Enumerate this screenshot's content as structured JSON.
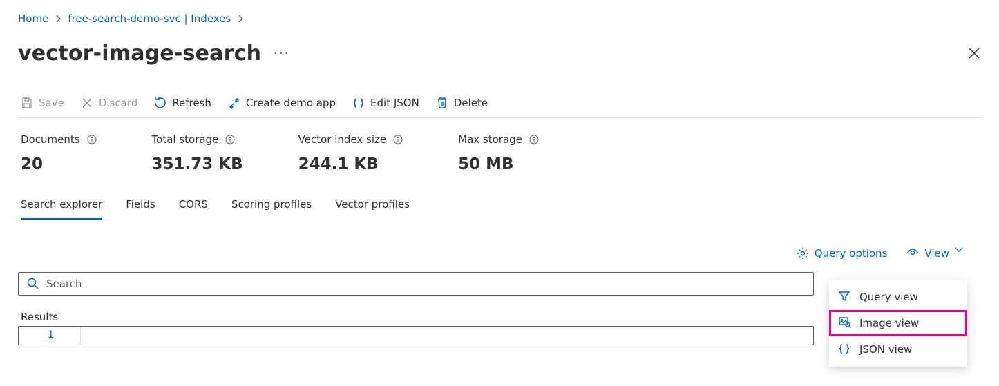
{
  "breadcrumb": {
    "home": "Home",
    "service": "free-search-demo-svc | Indexes"
  },
  "title": "vector-image-search",
  "toolbar": {
    "save": "Save",
    "discard": "Discard",
    "refresh": "Refresh",
    "create_demo": "Create demo app",
    "edit_json": "Edit JSON",
    "delete": "Delete"
  },
  "stats": {
    "documents": {
      "label": "Documents",
      "value": "20"
    },
    "total_storage": {
      "label": "Total storage",
      "value": "351.73 KB"
    },
    "vector_index": {
      "label": "Vector index size",
      "value": "244.1 KB"
    },
    "max_storage": {
      "label": "Max storage",
      "value": "50 MB"
    }
  },
  "tabs": {
    "search_explorer": "Search explorer",
    "fields": "Fields",
    "cors": "CORS",
    "scoring": "Scoring profiles",
    "vector": "Vector profiles"
  },
  "options": {
    "query_options": "Query options",
    "view": "View"
  },
  "search": {
    "placeholder": "Search"
  },
  "results": {
    "label": "Results",
    "line_number": "1"
  },
  "menu": {
    "query_view": "Query view",
    "image_view": "Image view",
    "json_view": "JSON view"
  }
}
